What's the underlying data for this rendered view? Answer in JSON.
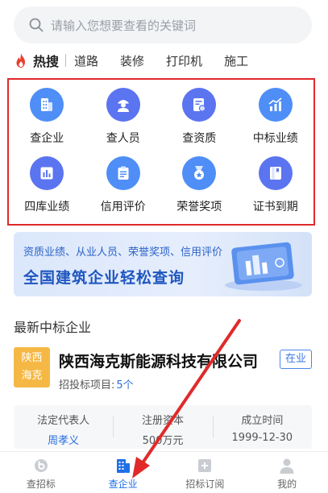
{
  "search": {
    "placeholder": "请输入您想要查看的关键词"
  },
  "hot": {
    "label": "热搜",
    "keywords": [
      "道路",
      "装修",
      "打印机",
      "施工"
    ]
  },
  "categories": [
    {
      "label": "查企业",
      "icon": "building-icon",
      "color": "#4f8ef7"
    },
    {
      "label": "查人员",
      "icon": "person-icon",
      "color": "#5b74f0"
    },
    {
      "label": "查资质",
      "icon": "certificate-icon",
      "color": "#5b74f0"
    },
    {
      "label": "中标业绩",
      "icon": "chart-up-icon",
      "color": "#4f8ef7"
    },
    {
      "label": "四库业绩",
      "icon": "bar-chart-icon",
      "color": "#5b74f0"
    },
    {
      "label": "信用评价",
      "icon": "clipboard-icon",
      "color": "#4f8ef7"
    },
    {
      "label": "荣誉奖项",
      "icon": "medal-icon",
      "color": "#4f8ef7"
    },
    {
      "label": "证书到期",
      "icon": "book-icon",
      "color": "#5b74f0"
    }
  ],
  "banner": {
    "subtitle": "资质业绩、从业人员、荣誉奖项、信用评价",
    "title": "全国建筑企业轻松查询"
  },
  "section": {
    "title": "最新中标企业"
  },
  "company": {
    "logo_line1": "陕西",
    "logo_line2": "海克",
    "name": "陕西海克斯能源科技有限公司",
    "status": "在业",
    "projects_label": "招投标项目:",
    "projects_count": "5个",
    "legal_rep_label": "法定代表人",
    "legal_rep": "周孝义",
    "capital_label": "注册资本",
    "capital": "500万元",
    "founded_label": "成立时间",
    "founded": "1999-12-30"
  },
  "tabs": [
    {
      "label": "查招标",
      "icon": "search-bid-icon",
      "active": false
    },
    {
      "label": "查企业",
      "icon": "building-icon",
      "active": true
    },
    {
      "label": "招标订阅",
      "icon": "subscribe-icon",
      "active": false
    },
    {
      "label": "我的",
      "icon": "user-icon",
      "active": false
    }
  ],
  "colors": {
    "accent": "#1f6fe8",
    "highlight_box": "#e02a2a",
    "arrow": "#e02a2a",
    "logo_bg": "#f5b844"
  }
}
